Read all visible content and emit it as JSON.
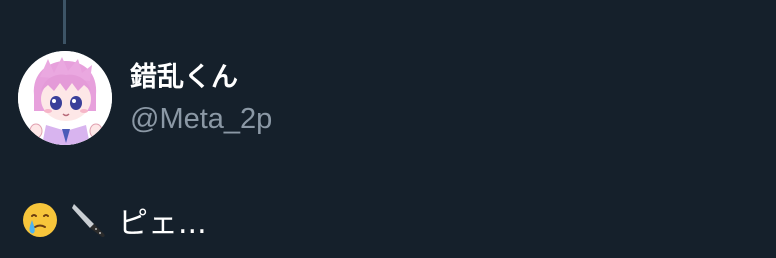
{
  "tweet": {
    "author": {
      "display_name": "錯乱くん",
      "handle": "@Meta_2p",
      "avatar_icon": "anime-avatar-icon"
    },
    "thread_line_color": "#3d5466",
    "content": {
      "emojis": [
        "face-holding-back-tears-icon",
        "knife-icon"
      ],
      "text": "ピェ..."
    }
  },
  "theme": {
    "background": "#15202b",
    "name_color": "#ffffff",
    "handle_color": "#8b98a5",
    "text_color": "#ffffff"
  }
}
